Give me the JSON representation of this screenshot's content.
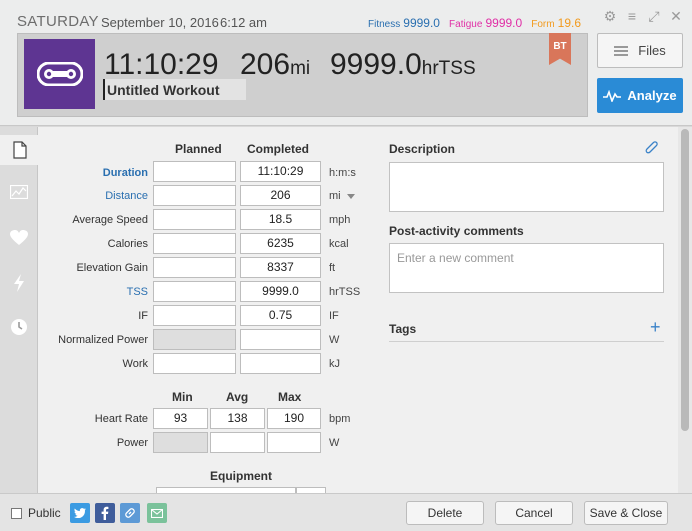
{
  "header": {
    "day": "SATURDAY",
    "date": "September 10, 2016",
    "time": "6:12 am",
    "fitness_label": "Fitness",
    "fitness_value": "9999.0",
    "fatigue_label": "Fatigue",
    "fatigue_value": "9999.0",
    "form_label": "Form",
    "form_value": "19.6"
  },
  "summary": {
    "duration": "11:10:29",
    "distance": "206",
    "distance_unit": "mi",
    "tss": "9999.0",
    "tss_unit": "hrTSS",
    "title_value": "Untitled Workout",
    "badge": "BT"
  },
  "buttons": {
    "files": "Files",
    "analyze": "Analyze",
    "delete": "Delete",
    "cancel": "Cancel",
    "save_close": "Save & Close"
  },
  "table": {
    "col_planned": "Planned",
    "col_completed": "Completed",
    "rows": [
      {
        "label": "Duration",
        "planned": "",
        "completed": "11:10:29",
        "unit": "h:m:s"
      },
      {
        "label": "Distance",
        "planned": "",
        "completed": "206",
        "unit": "mi"
      },
      {
        "label": "Average Speed",
        "planned": "",
        "completed": "18.5",
        "unit": "mph"
      },
      {
        "label": "Calories",
        "planned": "",
        "completed": "6235",
        "unit": "kcal"
      },
      {
        "label": "Elevation Gain",
        "planned": "",
        "completed": "8337",
        "unit": "ft"
      },
      {
        "label": "TSS",
        "planned": "",
        "completed": "9999.0",
        "unit": "hrTSS"
      },
      {
        "label": "IF",
        "planned": "",
        "completed": "0.75",
        "unit": "IF"
      },
      {
        "label": "Normalized Power",
        "planned": "",
        "completed": "",
        "unit": "W"
      },
      {
        "label": "Work",
        "planned": "",
        "completed": "",
        "unit": "kJ"
      }
    ]
  },
  "hr_table": {
    "col_min": "Min",
    "col_avg": "Avg",
    "col_max": "Max",
    "rows": [
      {
        "label": "Heart Rate",
        "min": "93",
        "avg": "138",
        "max": "190",
        "unit": "bpm"
      },
      {
        "label": "Power",
        "min": "",
        "avg": "",
        "max": "",
        "unit": "W"
      }
    ]
  },
  "equipment_label": "Equipment",
  "description": {
    "label": "Description"
  },
  "comments": {
    "label": "Post-activity comments",
    "placeholder": "Enter a new comment"
  },
  "tags": {
    "label": "Tags"
  },
  "footer": {
    "public_label": "Public"
  },
  "colors": {
    "accent": "#2a8bd6",
    "sport": "#5e3592",
    "fitness": "#2a6fb0",
    "fatigue": "#e02fa6",
    "form": "#f29a1d"
  }
}
